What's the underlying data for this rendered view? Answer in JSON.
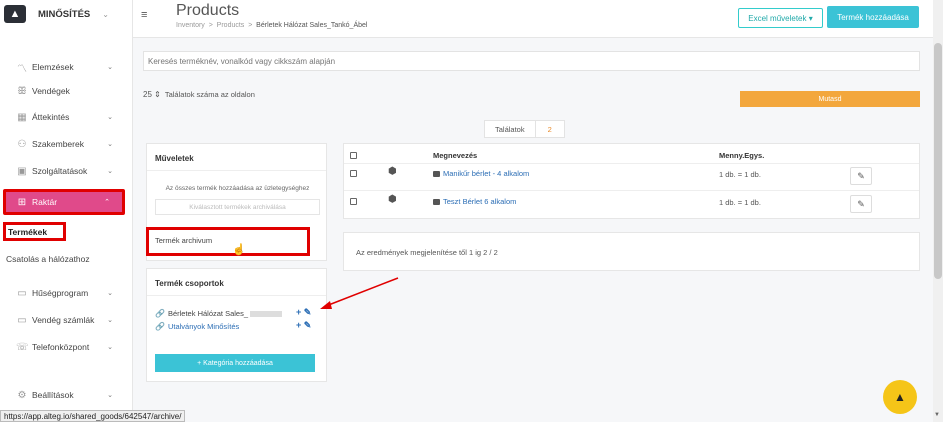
{
  "brand": {
    "name": "MINŐSÍTÉS",
    "logo_icon": "company-logo-icon",
    "caret": "⌄"
  },
  "sidebar": {
    "items": [
      {
        "label": "Elemzések",
        "icon": "analytics-icon",
        "glyph": "〽",
        "chev": "⌄"
      },
      {
        "label": "Vendégek",
        "icon": "guests-icon",
        "glyph": "ꕥ",
        "chev": ""
      },
      {
        "label": "Áttekintés",
        "icon": "grid-icon",
        "glyph": "▦",
        "chev": "⌄"
      },
      {
        "label": "Szakemberek",
        "icon": "person-icon",
        "glyph": "⚇",
        "chev": "⌄"
      },
      {
        "label": "Szolgáltatások",
        "icon": "services-icon",
        "glyph": "▣",
        "chev": "⌄"
      },
      {
        "label": "Raktár",
        "icon": "warehouse-icon",
        "glyph": "⊞",
        "chev": "⌃"
      },
      {
        "label": "Hűségprogram",
        "icon": "loyalty-icon",
        "glyph": "▭",
        "chev": "⌄"
      },
      {
        "label": "Vendég számlák",
        "icon": "wallet-icon",
        "glyph": "▭",
        "chev": "⌄"
      },
      {
        "label": "Telefonközpont",
        "icon": "phone-icon",
        "glyph": "☏",
        "chev": "⌄"
      },
      {
        "label": "Beállítások",
        "icon": "settings-icon",
        "glyph": "⚙",
        "chev": "⌄"
      }
    ],
    "sub_items": {
      "termekek": "Termékek",
      "csatolas": "Csatolás a hálózathoz"
    }
  },
  "header": {
    "menu_glyph": "≡",
    "title": "Products",
    "breadcrumb": {
      "a": "Inventory",
      "sep1": ">",
      "b": "Products",
      "sep2": ">",
      "current": "Bérletek Hálózat Sales_Tankó_Ábel"
    },
    "excel_label": "Excel műveletek ▾",
    "add_product_label": "Termék hozzáadása"
  },
  "search": {
    "placeholder": "Keresés terméknév, vonalkód vagy cikkszám alapján"
  },
  "pagination": {
    "per_page": "25",
    "per_page_arrow": "⇕",
    "per_page_label": "Találatok száma az oldalon",
    "show_label": "Mutasd"
  },
  "results": {
    "label": "Találatok",
    "count": "2",
    "summary": "Az eredmények megjelenítése től 1 ig 2 / 2"
  },
  "muveletek": {
    "title": "Műveletek",
    "add_all": "Az összes termék hozzáadása az üzletegységhez",
    "archive_selected": "Kiválasztott termékek archiválása",
    "archive_link": "Termék archivum"
  },
  "groups": {
    "title": "Termék csoportok",
    "items": [
      {
        "name": "Bérletek Hálózat Sales_",
        "link_icon": "🔗"
      },
      {
        "name": "Utalványok Minősítés",
        "link_icon": "🔗"
      }
    ],
    "actions": "+ ✎",
    "add_category": "+ Kategória hozzáadása"
  },
  "table": {
    "headers": {
      "name": "Megnevezés",
      "unit": "Menny.Egys."
    },
    "rows": [
      {
        "name": "Manikűr bérlet - 4 alkalom",
        "unit": "1 db. = 1 db.",
        "box": "⬢",
        "edit": "✎"
      },
      {
        "name": "Teszt Bérlet 6 alkalom",
        "unit": "1 db. = 1 db.",
        "box": "⬢",
        "edit": "✎"
      }
    ]
  },
  "status_url": "https://app.alteg.io/shared_goods/642547/archive/",
  "fab_glyph": "▲",
  "scroll_down_glyph": "▼",
  "cursor_glyph": "☝",
  "colors": {
    "accent": "#3bc3d6",
    "active": "#e04a8a",
    "highlight": "#e00000",
    "orange": "#f3a73d",
    "link": "#2c6eb5"
  }
}
